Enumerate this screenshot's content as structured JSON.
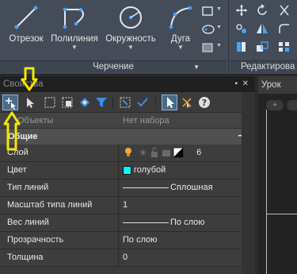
{
  "ribbon": {
    "tools": [
      {
        "label": "Отрезок",
        "icon": "line-icon"
      },
      {
        "label": "Полилиния",
        "icon": "polyline-icon"
      },
      {
        "label": "Окружность",
        "icon": "circle-icon"
      },
      {
        "label": "Дуга",
        "icon": "arc-icon"
      }
    ],
    "panel_drawing": "Черчение",
    "panel_edit": "Редактирова"
  },
  "properties": {
    "title": "Свойства",
    "objects_label": "Объекты",
    "objects_value": "Нет набора",
    "general_header": "Общие",
    "rows": [
      {
        "name": "Слой",
        "value": "6"
      },
      {
        "name": "Цвет",
        "value": "голубой",
        "swatch": "#00ffff"
      },
      {
        "name": "Тип линий",
        "value": "Сплошная"
      },
      {
        "name": "Масштаб типа линий",
        "value": "1"
      },
      {
        "name": "Вес линий",
        "value": "По слою"
      },
      {
        "name": "Прозрачность",
        "value": "По слою"
      },
      {
        "name": "Толщина",
        "value": "0"
      }
    ]
  },
  "viewport": {
    "tab": "Урок"
  },
  "colors": {
    "annotation": "#f5e600",
    "ribbon_bg": "#434c58",
    "panel_bg": "#3b3b3b",
    "select_blue": "#3a8ee6"
  }
}
